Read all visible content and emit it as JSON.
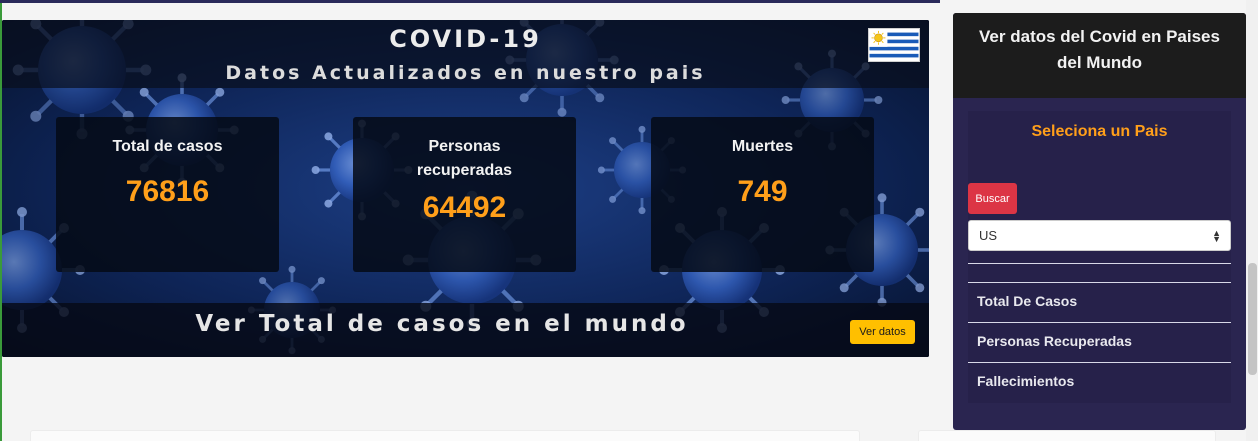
{
  "hero": {
    "title": "COVID-19",
    "subtitle": "Datos Actualizados en nuestro pais",
    "flag_icon": "uruguay-flag-icon",
    "stats": [
      {
        "label": "Total de casos",
        "value": "76816"
      },
      {
        "label": "Personas recuperadas",
        "value": "64492"
      },
      {
        "label": "Muertes",
        "value": "749"
      }
    ],
    "footer_text": "Ver Total de casos en el mundo",
    "ver_datos_label": "Ver datos"
  },
  "sidebar": {
    "title": "Ver datos del Covid en Paises del Mundo",
    "select_title": "Seleciona un Pais",
    "buscar_label": "Buscar",
    "selected_country": "US",
    "items": [
      {
        "label": "Total De Casos"
      },
      {
        "label": "Personas Recuperadas"
      },
      {
        "label": "Fallecimientos"
      }
    ]
  },
  "colors": {
    "accent_orange": "#ff9f1a",
    "button_yellow": "#ffbf00",
    "button_red": "#dc3545",
    "sidebar_bg": "#2a2550"
  }
}
